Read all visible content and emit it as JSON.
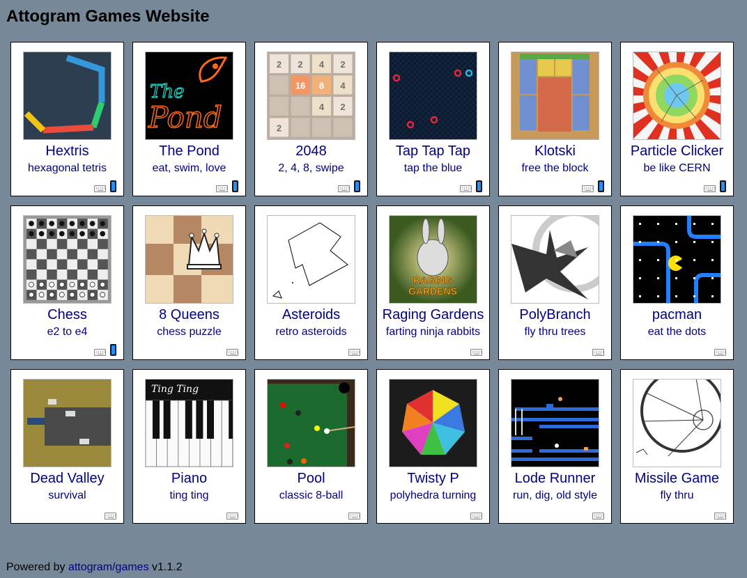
{
  "page": {
    "title": "Attogram Games Website"
  },
  "games": [
    {
      "title": "Hextris",
      "subtitle": "hexagonal tetris",
      "thumb_icon": "hextris-thumbnail",
      "keyboard": true,
      "mobile": true
    },
    {
      "title": "The Pond",
      "subtitle": "eat, swim, love",
      "thumb_icon": "pond-thumbnail",
      "thumb_text": "The Pond",
      "keyboard": true,
      "mobile": true
    },
    {
      "title": "2048",
      "subtitle": "2, 4, 8, swipe",
      "thumb_icon": "2048-thumbnail",
      "tiles": [
        "2",
        "2",
        "4",
        "2",
        "",
        "16",
        "8",
        "4",
        "",
        "",
        "4",
        "2",
        "2",
        "",
        "",
        ""
      ],
      "keyboard": true,
      "mobile": true
    },
    {
      "title": "Tap Tap Tap",
      "subtitle": "tap the blue",
      "thumb_icon": "taptaptap-thumbnail",
      "keyboard": true,
      "mobile": true
    },
    {
      "title": "Klotski",
      "subtitle": "free the block",
      "thumb_icon": "klotski-thumbnail",
      "keyboard": true,
      "mobile": true
    },
    {
      "title": "Particle Clicker",
      "subtitle": "be like CERN",
      "thumb_icon": "particle-clicker-thumbnail",
      "keyboard": true,
      "mobile": true
    },
    {
      "title": "Chess",
      "subtitle": "e2 to e4",
      "thumb_icon": "chess-thumbnail",
      "keyboard": true,
      "mobile": true
    },
    {
      "title": "8 Queens",
      "subtitle": "chess puzzle",
      "thumb_icon": "8queens-thumbnail",
      "keyboard": true,
      "mobile": false
    },
    {
      "title": "Asteroids",
      "subtitle": "retro asteroids",
      "thumb_icon": "asteroids-thumbnail",
      "keyboard": true,
      "mobile": false
    },
    {
      "title": "Raging Gardens",
      "subtitle": "farting ninja rabbits",
      "thumb_icon": "raging-gardens-thumbnail",
      "thumb_text": "RAGING GARDENS",
      "keyboard": true,
      "mobile": false
    },
    {
      "title": "PolyBranch",
      "subtitle": "fly thru trees",
      "thumb_icon": "polybranch-thumbnail",
      "keyboard": true,
      "mobile": false
    },
    {
      "title": "pacman",
      "subtitle": "eat the dots",
      "thumb_icon": "pacman-thumbnail",
      "keyboard": true,
      "mobile": false
    },
    {
      "title": "Dead Valley",
      "subtitle": "survival",
      "thumb_icon": "dead-valley-thumbnail",
      "keyboard": true,
      "mobile": false
    },
    {
      "title": "Piano",
      "subtitle": "ting ting",
      "thumb_icon": "piano-thumbnail",
      "thumb_text": "Ting Ting",
      "keyboard": true,
      "mobile": false
    },
    {
      "title": "Pool",
      "subtitle": "classic 8-ball",
      "thumb_icon": "pool-thumbnail",
      "keyboard": true,
      "mobile": false
    },
    {
      "title": "Twisty P",
      "subtitle": "polyhedra turning",
      "thumb_icon": "twisty-polyhedra-thumbnail",
      "keyboard": true,
      "mobile": false
    },
    {
      "title": "Lode Runner",
      "subtitle": "run, dig, old style",
      "thumb_icon": "lode-runner-thumbnail",
      "keyboard": true,
      "mobile": false
    },
    {
      "title": "Missile Game",
      "subtitle": "fly thru",
      "thumb_icon": "missile-game-thumbnail",
      "keyboard": true,
      "mobile": false
    }
  ],
  "footer": {
    "prefix": "Powered by",
    "link_text": "attogram/games",
    "version": "v1.1.2"
  }
}
